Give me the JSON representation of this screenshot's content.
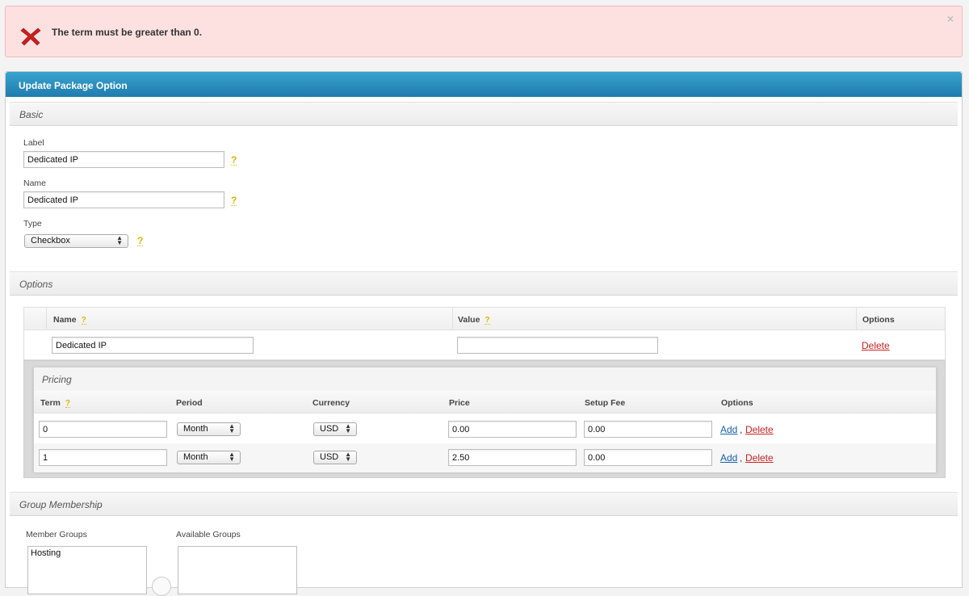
{
  "alert": {
    "message": "The term must be greater than 0.",
    "close": "×"
  },
  "panel": {
    "title": "Update Package Option"
  },
  "basic": {
    "section_title": "Basic",
    "label_label": "Label",
    "label_value": "Dedicated IP",
    "name_label": "Name",
    "name_value": "Dedicated IP",
    "type_label": "Type",
    "type_value": "Checkbox",
    "help": "?"
  },
  "options": {
    "section_title": "Options",
    "col_name": "Name",
    "col_value": "Value",
    "col_options": "Options",
    "row": {
      "name": "Dedicated IP",
      "value": "",
      "delete": "Delete"
    }
  },
  "pricing": {
    "title": "Pricing",
    "cols": {
      "term": "Term",
      "period": "Period",
      "currency": "Currency",
      "price": "Price",
      "setup_fee": "Setup Fee",
      "options": "Options"
    },
    "rows": [
      {
        "term": "0",
        "period": "Month",
        "currency": "USD",
        "price": "0.00",
        "setup_fee": "0.00",
        "add": "Add",
        "delete": "Delete"
      },
      {
        "term": "1",
        "period": "Month",
        "currency": "USD",
        "price": "2.50",
        "setup_fee": "0.00",
        "add": "Add",
        "delete": "Delete"
      }
    ]
  },
  "groups": {
    "section_title": "Group Membership",
    "member_label": "Member Groups",
    "member_items": [
      "Hosting"
    ],
    "available_label": "Available Groups"
  },
  "colors": {
    "header": "#1f7cae",
    "alert_bg": "#fde1e1",
    "delete": "#cc2222",
    "add": "#1a5fa8",
    "help": "#d9b800"
  },
  "icons": {
    "error": "x-icon",
    "close": "close-icon",
    "help": "help-icon",
    "select_arrows": "updown-arrows-icon"
  }
}
